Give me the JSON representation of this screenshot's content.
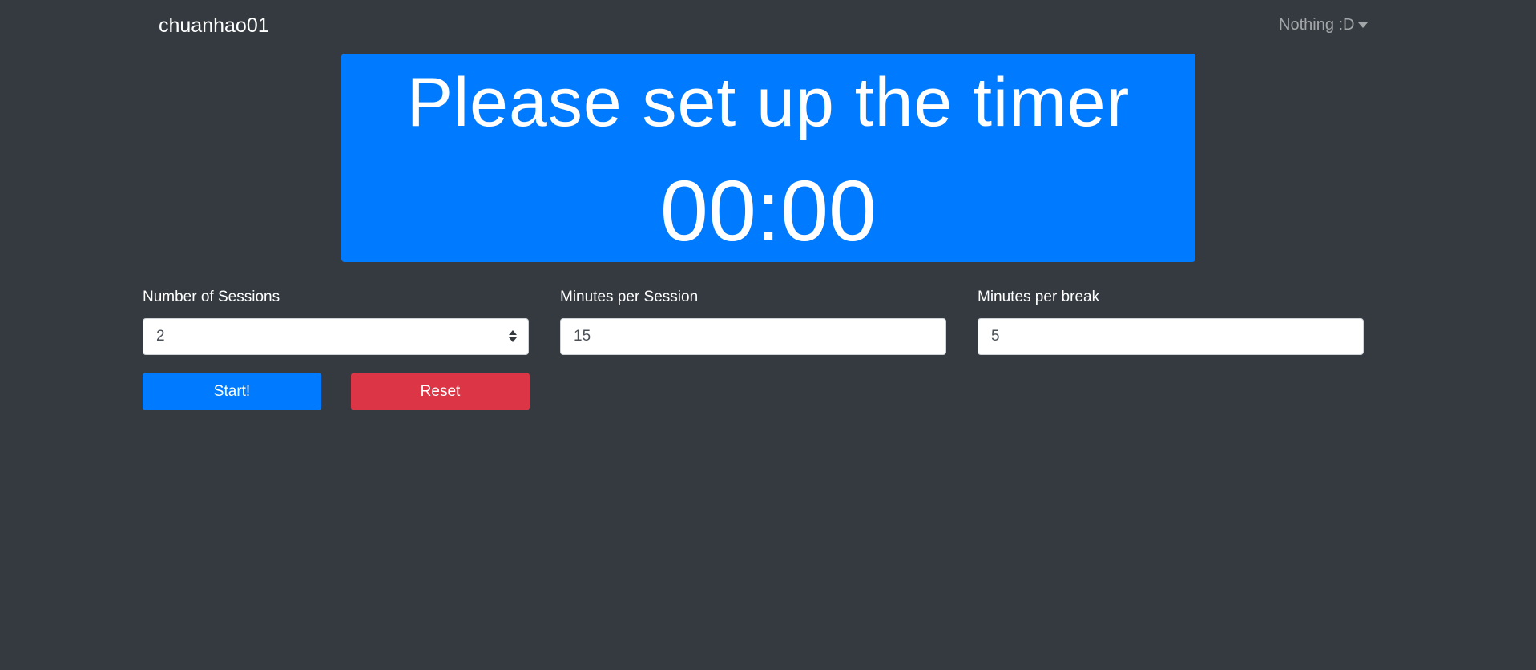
{
  "navbar": {
    "brand": "chuanhao01",
    "dropdown_label": "Nothing :D"
  },
  "timer": {
    "status_text": "Please set up the timer",
    "time_display": "00:00",
    "background_color": "#007bff"
  },
  "form": {
    "sessions": {
      "label": "Number of Sessions",
      "value": "2"
    },
    "minutes_per_session": {
      "label": "Minutes per Session",
      "value": "15"
    },
    "minutes_per_break": {
      "label": "Minutes per break",
      "value": "5"
    }
  },
  "buttons": {
    "start_label": "Start!",
    "reset_label": "Reset"
  },
  "colors": {
    "page_background": "#343a40",
    "primary": "#007bff",
    "danger": "#dc3545"
  }
}
